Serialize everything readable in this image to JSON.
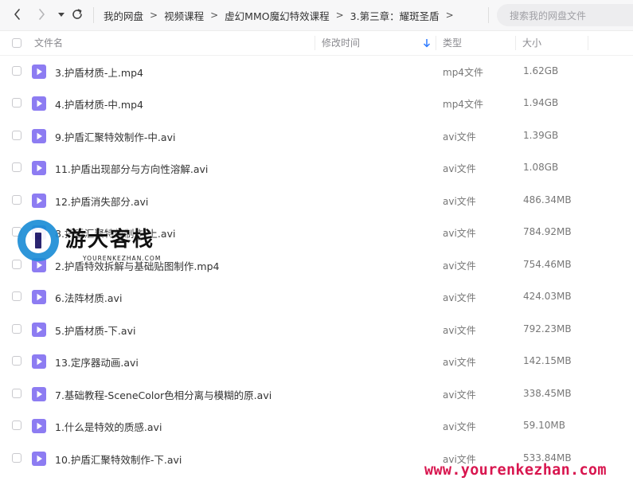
{
  "breadcrumbs": [
    "我的网盘",
    "视频课程",
    "虚幻MMO魔幻特效课程",
    "3.第三章：耀斑圣盾"
  ],
  "breadcrumb_separator": ">",
  "search": {
    "placeholder": "搜索我的网盘文件"
  },
  "columns": {
    "name": "文件名",
    "modified": "修改时间",
    "type": "类型",
    "size": "大小"
  },
  "files": [
    {
      "name": "3.护盾材质-上.mp4",
      "type": "mp4文件",
      "size": "1.62GB"
    },
    {
      "name": "4.护盾材质-中.mp4",
      "type": "mp4文件",
      "size": "1.94GB"
    },
    {
      "name": "9.护盾汇聚特效制作-中.avi",
      "type": "avi文件",
      "size": "1.39GB"
    },
    {
      "name": "11.护盾出现部分与方向性溶解.avi",
      "type": "avi文件",
      "size": "1.08GB"
    },
    {
      "name": "12.护盾消失部分.avi",
      "type": "avi文件",
      "size": "486.34MB"
    },
    {
      "name": "8.护盾汇聚特效制作-上.avi",
      "type": "avi文件",
      "size": "784.92MB"
    },
    {
      "name": "2.护盾特效拆解与基础贴图制作.mp4",
      "type": "avi文件",
      "size": "754.46MB"
    },
    {
      "name": "6.法阵材质.avi",
      "type": "avi文件",
      "size": "424.03MB"
    },
    {
      "name": "5.护盾材质-下.avi",
      "type": "avi文件",
      "size": "792.23MB"
    },
    {
      "name": "13.定序器动画.avi",
      "type": "avi文件",
      "size": "142.15MB"
    },
    {
      "name": "7.基础教程-SceneColor色相分离与模糊的原.avi",
      "type": "avi文件",
      "size": "338.45MB"
    },
    {
      "name": "1.什么是特效的质感.avi",
      "type": "avi文件",
      "size": "59.10MB"
    },
    {
      "name": "10.护盾汇聚特效制作-下.avi",
      "type": "avi文件",
      "size": "533.84MB"
    }
  ],
  "watermark": {
    "logo_text": "游大客栈",
    "logo_sub": "YOURENKEZHAN.COM",
    "url": "www.yourenkezhan.com"
  },
  "colors": {
    "accent": "#2e7bff",
    "file_icon": "#8d7cf2",
    "watermark_url": "#d8164f",
    "logo_blue": "#1d8ed6"
  },
  "icons": {
    "back": "chevron-left-icon",
    "forward": "chevron-right-icon",
    "history": "caret-down-icon",
    "refresh": "refresh-icon",
    "file": "video-file-icon",
    "sort": "sort-down-arrow-icon"
  }
}
